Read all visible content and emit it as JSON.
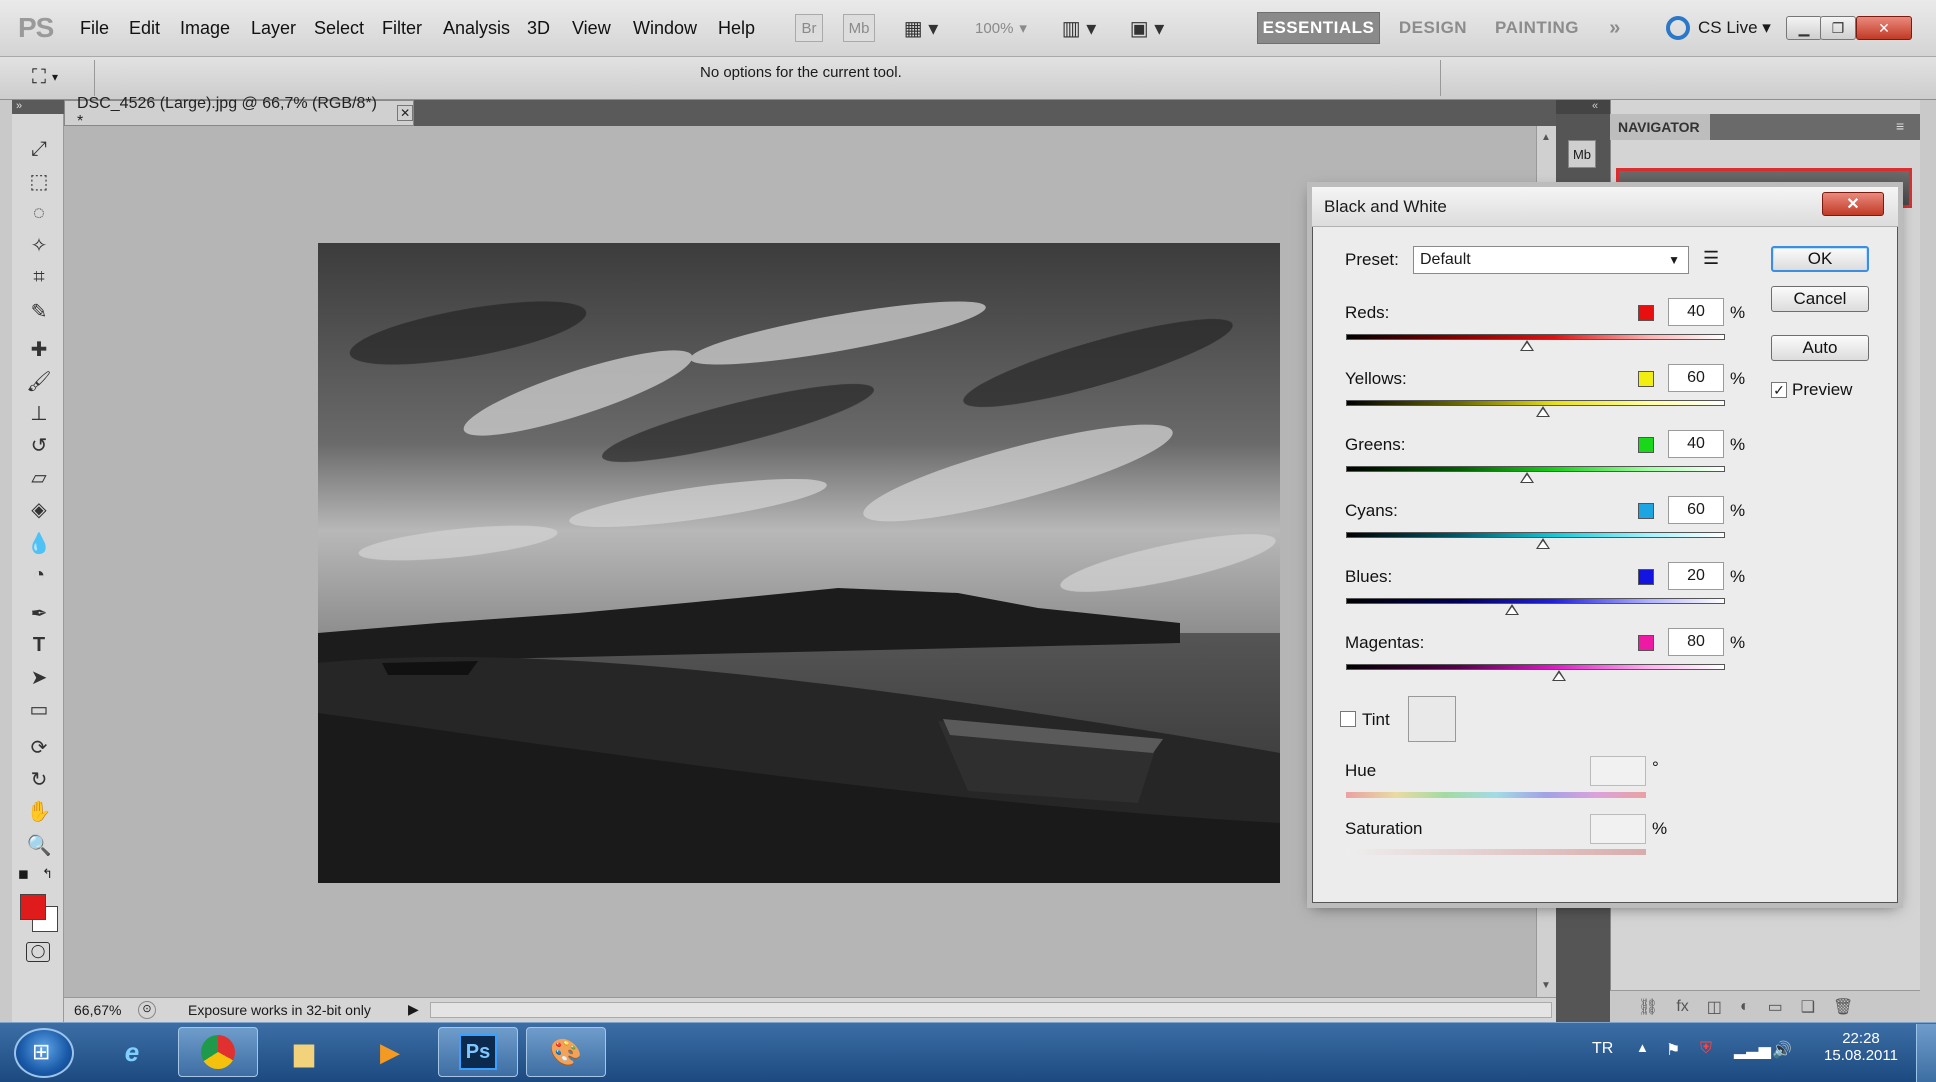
{
  "app": {
    "logo": "PS"
  },
  "menu": [
    "File",
    "Edit",
    "Image",
    "Layer",
    "Select",
    "Filter",
    "Analysis",
    "3D",
    "View",
    "Window",
    "Help"
  ],
  "toolbar_top": {
    "br_label": "Br",
    "mb_label": "Mb",
    "zoom_label": "100%"
  },
  "workspaces": [
    "ESSENTIALS",
    "DESIGN",
    "PAINTING"
  ],
  "cs_live": "CS Live",
  "options_bar": {
    "message": "No options for the current tool."
  },
  "document": {
    "tab_title": "DSC_4526 (Large).jpg @ 66,7% (RGB/8*) *"
  },
  "status_bar": {
    "zoom": "66,67%",
    "message": "Exposure works in 32-bit only"
  },
  "panel": {
    "navigator_tab": "NAVIGATOR"
  },
  "dialog": {
    "title": "Black and White",
    "preset_label": "Preset:",
    "preset_value": "Default",
    "buttons": {
      "ok": "OK",
      "cancel": "Cancel",
      "auto": "Auto"
    },
    "preview_label": "Preview",
    "preview_checked": true,
    "percent": "%",
    "channels": [
      {
        "label": "Reds:",
        "value": "40",
        "color": "#e8100f"
      },
      {
        "label": "Yellows:",
        "value": "60",
        "color": "#f2ee10"
      },
      {
        "label": "Greens:",
        "value": "40",
        "color": "#19d719"
      },
      {
        "label": "Cyans:",
        "value": "60",
        "color": "#1da4e3"
      },
      {
        "label": "Blues:",
        "value": "20",
        "color": "#1414e0"
      },
      {
        "label": "Magentas:",
        "value": "80",
        "color": "#ef1aa4"
      }
    ],
    "tint_label": "Tint",
    "hue_label": "Hue",
    "degree": "°",
    "saturation_label": "Saturation"
  },
  "taskbar": {
    "lang": "TR",
    "time": "22:28",
    "date": "15.08.2011",
    "ps_label": "Ps"
  }
}
